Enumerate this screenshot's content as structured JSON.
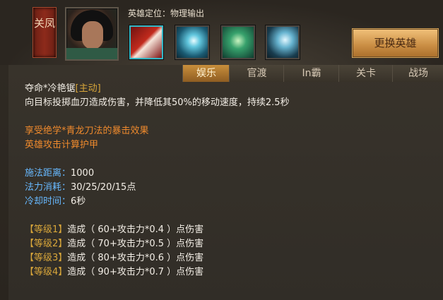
{
  "hero": {
    "name": "关凤",
    "role_label": "英雄定位：物理输出"
  },
  "switch_hero_label": "更换英雄",
  "tabs": [
    {
      "label": "娱乐",
      "active": true
    },
    {
      "label": "官渡",
      "active": false
    },
    {
      "label": "In霸",
      "active": false
    },
    {
      "label": "关卡",
      "active": false
    },
    {
      "label": "战场",
      "active": false
    }
  ],
  "skill": {
    "name": "夺命*冷艳锯",
    "type": "[主动]",
    "description": "向目标投掷血刃造成伤害，并降低其50%的移动速度，持续2.5秒",
    "special_1": "享受绝学*青龙刀法的暴击效果",
    "special_2": "英雄攻击计算护甲",
    "range_label": "施法距离：",
    "range_value": "1000",
    "mana_label": "法力消耗：",
    "mana_value": "30/25/20/15点",
    "cooldown_label": "冷却时间：",
    "cooldown_value": "6秒",
    "levels": [
      {
        "tag": "【等级1】",
        "text": "造成（ 60+攻击力*0.4 ）点伤害"
      },
      {
        "tag": "【等级2】",
        "text": "造成（ 70+攻击力*0.5 ）点伤害"
      },
      {
        "tag": "【等级3】",
        "text": "造成（ 80+攻击力*0.6 ）点伤害"
      },
      {
        "tag": "【等级4】",
        "text": "造成（ 90+攻击力*0.7 ）点伤害"
      }
    ]
  },
  "colors": {
    "accent": "#e0a347",
    "orange_text": "#ef8a2d",
    "blue_text": "#67b9ff",
    "gold_text": "#d8a63a"
  }
}
